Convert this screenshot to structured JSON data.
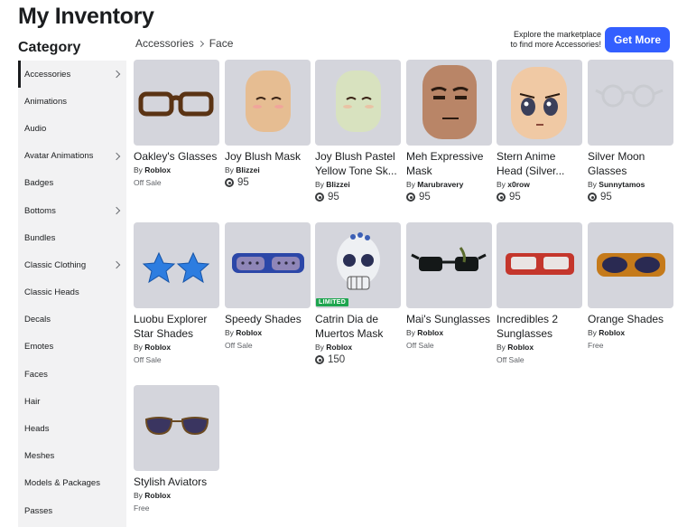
{
  "page_title": "My Inventory",
  "category_title": "Category",
  "breadcrumb": {
    "parent": "Accessories",
    "current": "Face"
  },
  "promo": {
    "line1": "Explore the marketplace",
    "line2": "to find more Accessories!",
    "button": "Get More"
  },
  "sidebar": {
    "items": [
      {
        "label": "Accessories",
        "chevron": true,
        "active": true
      },
      {
        "label": "Animations",
        "chevron": false
      },
      {
        "label": "Audio",
        "chevron": false
      },
      {
        "label": "Avatar Animations",
        "chevron": true
      },
      {
        "label": "Badges",
        "chevron": false
      },
      {
        "label": "Bottoms",
        "chevron": true
      },
      {
        "label": "Bundles",
        "chevron": false
      },
      {
        "label": "Classic Clothing",
        "chevron": true
      },
      {
        "label": "Classic Heads",
        "chevron": false
      },
      {
        "label": "Decals",
        "chevron": false
      },
      {
        "label": "Emotes",
        "chevron": false
      },
      {
        "label": "Faces",
        "chevron": false
      },
      {
        "label": "Hair",
        "chevron": false
      },
      {
        "label": "Heads",
        "chevron": false
      },
      {
        "label": "Meshes",
        "chevron": false
      },
      {
        "label": "Models & Packages",
        "chevron": false
      },
      {
        "label": "Passes",
        "chevron": false
      }
    ]
  },
  "by_label": "By",
  "items": [
    {
      "name": "Oakley's Glasses",
      "creator": "Roblox",
      "price": "Off Sale",
      "robux": null,
      "image": "brown-glasses",
      "limited": false
    },
    {
      "name": "Joy Blush Mask",
      "creator": "Blizzei",
      "price": null,
      "robux": "95",
      "image": "tan-mask",
      "limited": false
    },
    {
      "name": "Joy Blush Pastel Yellow Tone Sk...",
      "creator": "Blizzei",
      "price": null,
      "robux": "95",
      "image": "yellow-mask",
      "limited": false
    },
    {
      "name": "Meh Expressive Mask",
      "creator": "Marubravery",
      "price": null,
      "robux": "95",
      "image": "meh-face",
      "limited": false
    },
    {
      "name": "Stern Anime Head (Silver...",
      "creator": "x0row",
      "price": null,
      "robux": "95",
      "image": "anime-head",
      "limited": false
    },
    {
      "name": "Silver Moon Glasses",
      "creator": "Sunnytamos",
      "price": null,
      "robux": "95",
      "image": "silver-glasses",
      "limited": false
    },
    {
      "name": "Luobu Explorer Star Shades",
      "creator": "Roblox",
      "price": "Off Sale",
      "robux": null,
      "image": "star-shades",
      "limited": false
    },
    {
      "name": "Speedy Shades",
      "creator": "Roblox",
      "price": "Off Sale",
      "robux": null,
      "image": "speedy-shades",
      "limited": false
    },
    {
      "name": "Catrin Dia de Muertos Mask",
      "creator": "Roblox",
      "price": null,
      "robux": "150",
      "image": "skull-mask",
      "limited": true,
      "limited_label": "LIMITED"
    },
    {
      "name": "Mai's Sunglasses",
      "creator": "Roblox",
      "price": "Off Sale",
      "robux": null,
      "image": "mai-sunglasses",
      "limited": false
    },
    {
      "name": "Incredibles 2 Sunglasses",
      "creator": "Roblox",
      "price": "Off Sale",
      "robux": null,
      "image": "incredibles-glasses",
      "limited": false
    },
    {
      "name": "Orange Shades",
      "creator": "Roblox",
      "price": "Free",
      "robux": null,
      "image": "orange-shades",
      "limited": false
    },
    {
      "name": "Stylish Aviators",
      "creator": "Roblox",
      "price": "Free",
      "robux": null,
      "image": "aviators",
      "limited": false
    }
  ]
}
